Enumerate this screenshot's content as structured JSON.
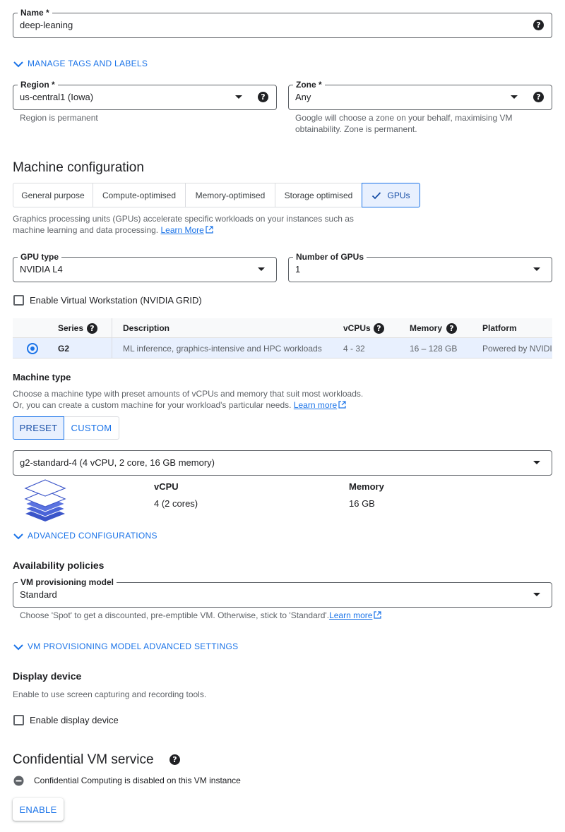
{
  "name_field": {
    "label": "Name *",
    "value": "deep-leaning"
  },
  "manage_tags": {
    "label": "MANAGE TAGS AND LABELS"
  },
  "region": {
    "label": "Region *",
    "value": "us-central1 (Iowa)",
    "hint": "Region is permanent"
  },
  "zone": {
    "label": "Zone *",
    "value": "Any",
    "hint_line1": "Google will choose a zone on your behalf, maximising VM",
    "hint_line2": "obtainability. Zone is permanent."
  },
  "machine_config": {
    "title": "Machine configuration",
    "tabs": [
      "General purpose",
      "Compute-optimised",
      "Memory-optimised",
      "Storage optimised",
      "GPUs"
    ],
    "selected_tab": "GPUs",
    "desc_line1": "Graphics processing units (GPUs) accelerate specific workloads on your instances such as",
    "desc_line2": "machine learning and data processing.",
    "learn_more": "Learn More"
  },
  "gpu_type": {
    "label": "GPU type",
    "value": "NVIDIA L4"
  },
  "gpu_count": {
    "label": "Number of GPUs",
    "value": "1"
  },
  "virtual_workstation": {
    "label": "Enable Virtual Workstation (NVIDIA GRID)",
    "checked": false
  },
  "series_table": {
    "headers": {
      "series": "Series",
      "description": "Description",
      "vcpus": "vCPUs",
      "memory": "Memory",
      "platform": "Platform"
    },
    "row": {
      "series": "G2",
      "description": "ML inference, graphics-intensive and HPC workloads",
      "vcpus": "4 - 32",
      "memory": "16 – 128 GB",
      "platform": "Powered by NVIDIA"
    }
  },
  "machine_type": {
    "title": "Machine type",
    "desc_line1": "Choose a machine type with preset amounts of vCPUs and memory that suit most workloads.",
    "desc_line2": "Or, you can create a custom machine for your workload's particular needs.",
    "learn_more": "Learn more",
    "preset_label": "PRESET",
    "custom_label": "CUSTOM",
    "selected": "PRESET",
    "select_value": "g2-standard-4 (4 vCPU, 2 core, 16 GB memory)",
    "vcpu_label": "vCPU",
    "vcpu_value": "4 (2 cores)",
    "memory_label": "Memory",
    "memory_value": "16 GB"
  },
  "advanced_configs": {
    "label": "ADVANCED CONFIGURATIONS"
  },
  "availability": {
    "title": "Availability policies",
    "provisioning_label": "VM provisioning model",
    "provisioning_value": "Standard",
    "hint": "Choose 'Spot' to get a discounted, pre-emptible VM. Otherwise, stick to 'Standard'.",
    "learn_more": "Learn more",
    "advanced_label": "VM PROVISIONING MODEL ADVANCED SETTINGS"
  },
  "display_device": {
    "title": "Display device",
    "desc": "Enable to use screen capturing and recording tools.",
    "checkbox_label": "Enable display device",
    "checked": false
  },
  "confidential": {
    "title": "Confidential VM service",
    "status": "Confidential Computing is disabled on this VM instance",
    "enable_label": "ENABLE"
  },
  "colors": {
    "accent": "#1a73e8",
    "selected_bg": "#e8f0fe",
    "text": "#202124",
    "muted": "#5f6368"
  }
}
